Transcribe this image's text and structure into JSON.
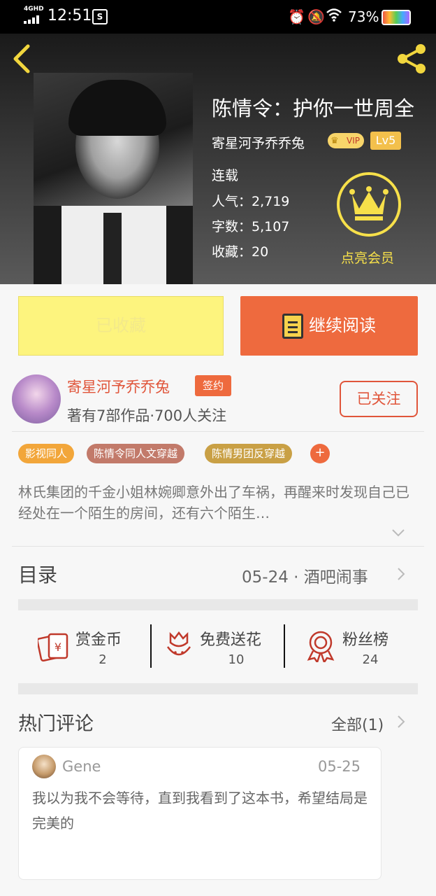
{
  "status_bar": {
    "network": "4GHD",
    "time": "12:51",
    "battery_percent": "73%"
  },
  "header": {
    "title": "陈情令：护你一世周全",
    "author": "寄星河予乔乔兔",
    "vip_badge": "VIP",
    "level": "Lv5",
    "state": "连载",
    "popularity": "人气：2,719",
    "word_count": "字数：5,107",
    "favorites": "收藏：20",
    "member_label": "点亮会员"
  },
  "actions": {
    "favorite_label": "已收藏",
    "read_label": "继续阅读"
  },
  "author_card": {
    "name": "寄星河予乔乔兔",
    "sign_badge": "签约",
    "meta": "著有7部作品·700人关注",
    "follow_label": "已关注"
  },
  "tags": [
    {
      "label": "影视同人",
      "color": "#f2a63a"
    },
    {
      "label": "陈情令同人文穿越",
      "color": "#c27a6a"
    },
    {
      "label": "陈情男团反穿越",
      "color": "#c9a045"
    }
  ],
  "tag_plus": "+",
  "description": "林氏集团的千金小姐林婉卿意外出了车祸，再醒来时发现自己已经处在一个陌生的房间，还有六个陌生…",
  "catalog": {
    "label": "目录",
    "latest": "05-24 · 酒吧闹事"
  },
  "stats": [
    {
      "label": "赏金币",
      "value": "2",
      "icon": "red-envelope-icon"
    },
    {
      "label": "免费送花",
      "value": "10",
      "icon": "flower-icon"
    },
    {
      "label": "粉丝榜",
      "value": "24",
      "icon": "medal-icon"
    }
  ],
  "comments": {
    "label": "热门评论",
    "all_label": "全部(1)",
    "items": [
      {
        "user": "Gene",
        "date": "05-25",
        "text": "我以为我不会等待，直到我看到了这本书，希望结局是完美的"
      }
    ]
  },
  "colors": {
    "accent": "#ee6a3e",
    "favorite_bg": "#fdf47e",
    "crown": "#f7e04a"
  }
}
